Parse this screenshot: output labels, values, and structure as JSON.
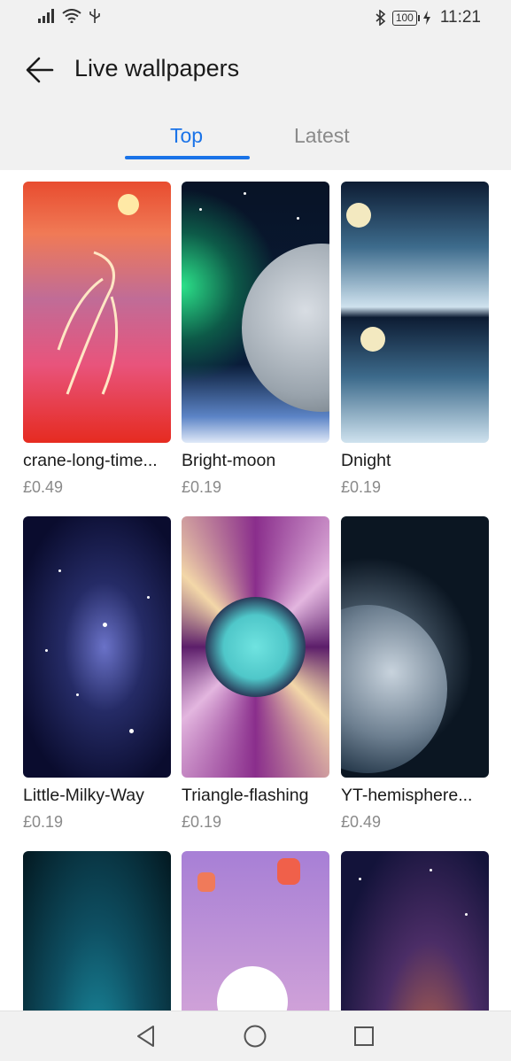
{
  "status_bar": {
    "icons_left": [
      "signal-icon",
      "wifi-icon",
      "usb-icon"
    ],
    "icons_right": [
      "bluetooth-icon",
      "battery-icon",
      "charging-icon"
    ],
    "battery": "100",
    "time": "11:21"
  },
  "header": {
    "title": "Live wallpapers",
    "tabs": [
      {
        "label": "Top",
        "selected": true
      },
      {
        "label": "Latest",
        "selected": false
      }
    ]
  },
  "wallpapers": [
    {
      "name": "crane-long-time...",
      "price": "£0.49"
    },
    {
      "name": "Bright-moon",
      "price": "£0.19"
    },
    {
      "name": "Dnight",
      "price": "£0.19"
    },
    {
      "name": "Little-Milky-Way",
      "price": "£0.19"
    },
    {
      "name": "Triangle-flashing",
      "price": "£0.19"
    },
    {
      "name": "YT-hemisphere...",
      "price": "£0.49"
    }
  ],
  "colors": {
    "accent": "#1a73e8",
    "bar_bg": "#f1f1f1",
    "secondary_text": "#8a8a8a"
  },
  "nav_bar": {
    "buttons": [
      "back-triangle-icon",
      "home-circle-icon",
      "recents-square-icon"
    ]
  }
}
